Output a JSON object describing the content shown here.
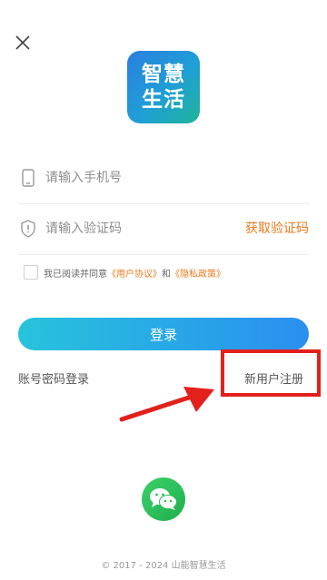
{
  "logo": {
    "line1": "智慧",
    "line2": "生活"
  },
  "form": {
    "phone_placeholder": "请输入手机号",
    "code_placeholder": "请输入验证码",
    "get_code_label": "获取验证码"
  },
  "agreement": {
    "prefix": "我已阅读并同意",
    "user_agreement": "《用户协议》",
    "and": "和",
    "privacy_policy": "《隐私政策》"
  },
  "login_button_label": "登录",
  "password_login_label": "账号密码登录",
  "register_label": "新用户注册",
  "footer_text": "© 2017 - 2024 山能智慧生活",
  "icons": {
    "close": "close-icon",
    "phone": "phone-icon",
    "code": "shield-icon",
    "wechat": "wechat-icon"
  },
  "colors": {
    "accent": "#ee7b1f",
    "button_start": "#27c3dc",
    "button_end": "#2a8ff0",
    "highlight": "#e3201b"
  }
}
